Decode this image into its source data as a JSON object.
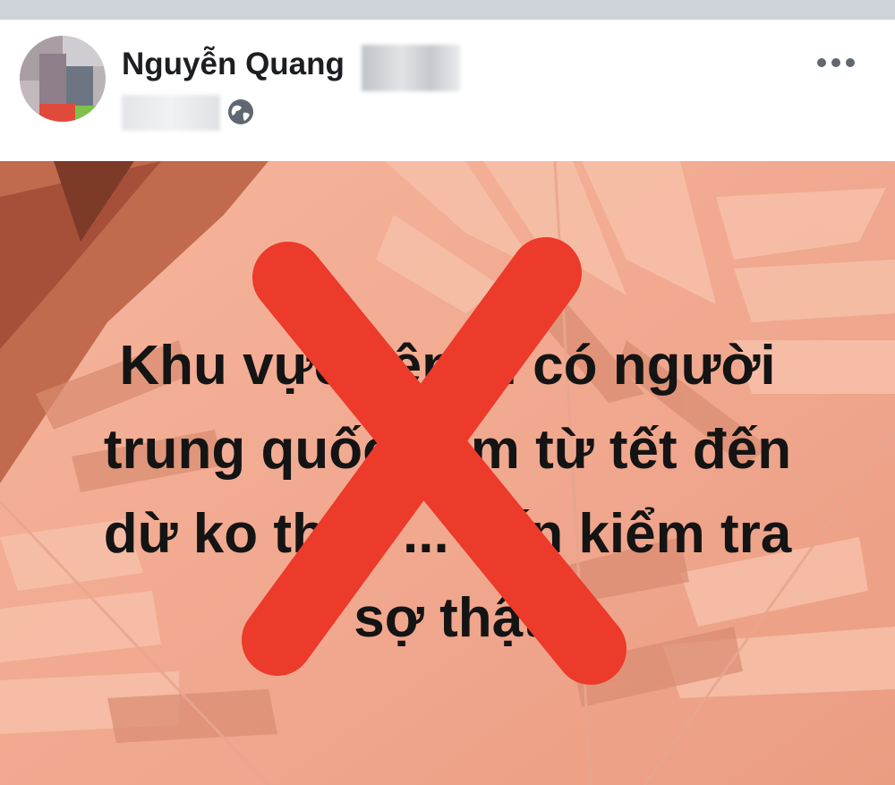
{
  "header": {
    "author_name": "Nguyễn Quang",
    "author_name_redacted": true,
    "post_time_redacted": true,
    "privacy_icon": "globe-icon",
    "menu_icon": "more-options-icon"
  },
  "post": {
    "text_lines": [
      "Khu vực yên ... có người",
      "trung quốc ... m từ tết đến",
      "dừ ko thấy ... đến kiểm tra",
      "sợ thật"
    ],
    "overlay_icon": "red-x-mark-icon",
    "background": "pink tropical leaves",
    "colors": {
      "background": "#f1a68c",
      "x_mark": "#ec3a2b",
      "text": "#141414"
    }
  }
}
